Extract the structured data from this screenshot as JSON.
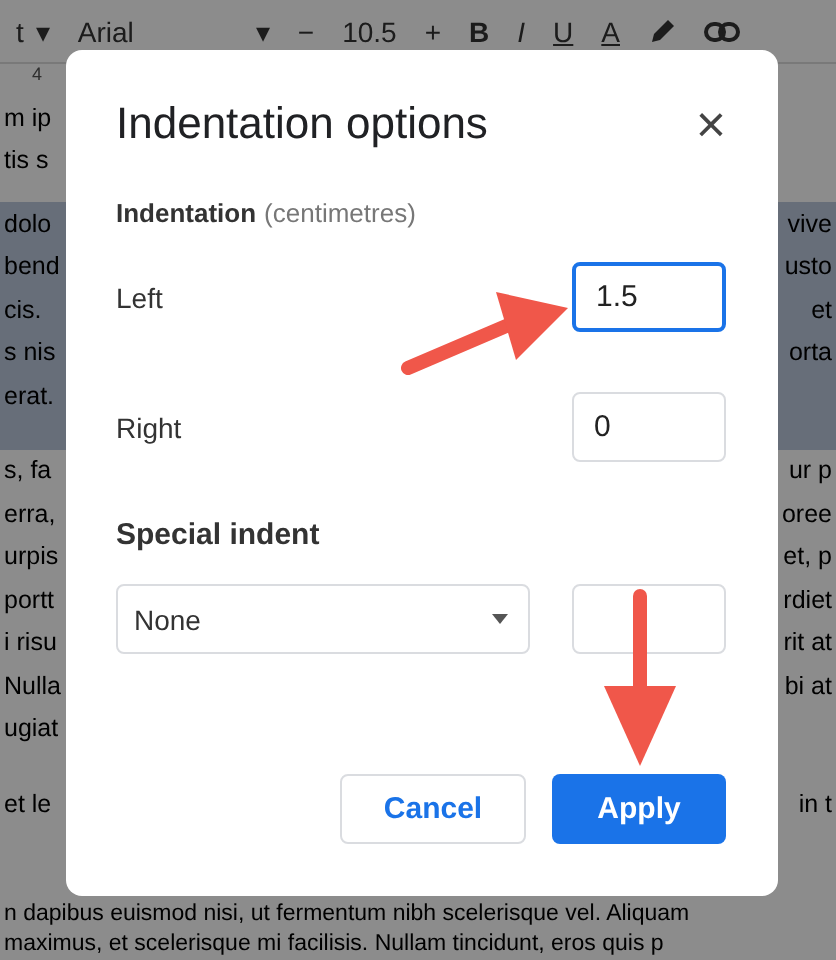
{
  "toolbar": {
    "style_label": "t",
    "caret": "▾",
    "font": "Arial",
    "size": "10.5",
    "minus": "−",
    "plus": "+",
    "bold": "B",
    "italic": "I",
    "underline": "U",
    "text_color": "A"
  },
  "ruler": {
    "mark": "4"
  },
  "document": {
    "paragraphs": [
      {
        "selected": false,
        "lines": [
          {
            "left": "m ip"
          },
          {
            "left": "tis s"
          }
        ]
      },
      {
        "selected": true,
        "lines": [
          {
            "left": "dolo",
            "right": "vive"
          },
          {
            "left": "bend",
            "right": "usto"
          },
          {
            "left": "cis.",
            "right": "et"
          },
          {
            "left": "s nis",
            "right": "orta"
          },
          {
            "left": "erat."
          }
        ]
      },
      {
        "selected": false,
        "lines": [
          {
            "left": "s, fa",
            "right": "ur p"
          },
          {
            "left": "erra,",
            "right": "oree"
          },
          {
            "left": "urpis",
            "right": "et, p"
          },
          {
            "left": "portt",
            "right": "rdiet"
          },
          {
            "left": "i risu",
            "right": "rit at"
          },
          {
            "left": "Nulla",
            "right": "bi at"
          },
          {
            "left": "ugiat"
          }
        ]
      },
      {
        "selected": false,
        "lines": [
          {
            "left": "et le",
            "right": "in t"
          }
        ]
      }
    ],
    "bottom_lines": [
      "n dapibus euismod nisi, ut fermentum nibh scelerisque vel. Aliquam",
      "maximus, et scelerisque mi facilisis. Nullam tincidunt, eros quis p"
    ]
  },
  "dialog": {
    "title": "Indentation options",
    "close": "×",
    "section": {
      "label": "Indentation",
      "unit": "(centimetres)"
    },
    "fields": [
      {
        "label": "Left",
        "value": "1.5",
        "focused": true
      },
      {
        "label": "Right",
        "value": "0",
        "focused": false
      }
    ],
    "special": {
      "label": "Special indent",
      "option": "None"
    },
    "buttons": [
      {
        "label": "Cancel",
        "kind": "secondary"
      },
      {
        "label": "Apply",
        "kind": "primary"
      }
    ]
  }
}
